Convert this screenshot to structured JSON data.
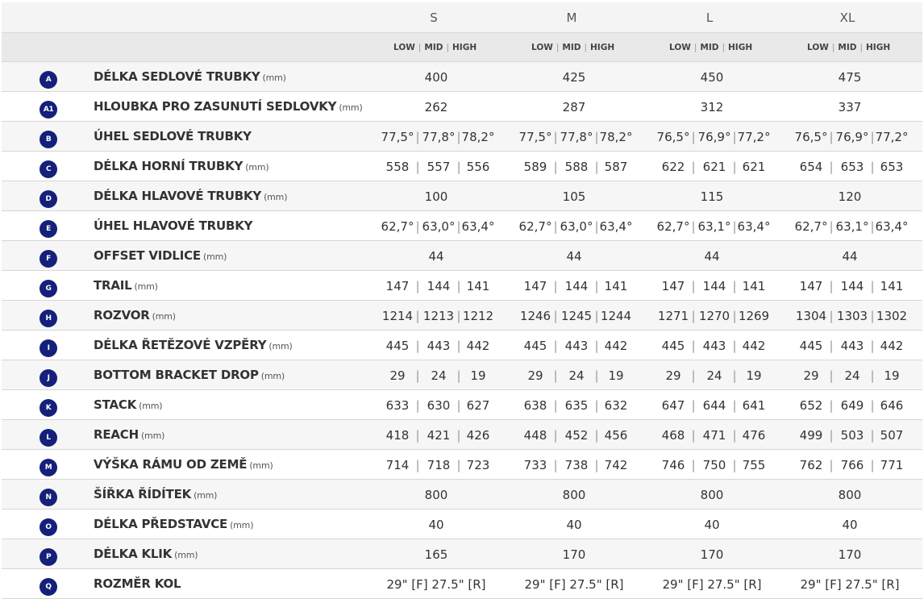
{
  "header": {
    "sizes": [
      "S",
      "M",
      "L",
      "XL"
    ],
    "sub": [
      "LOW",
      "MID",
      "HIGH"
    ],
    "sep": "|"
  },
  "rows": [
    {
      "badge": "A",
      "label": "DÉLKA SEDLOVÉ TRUBKY",
      "unit": "(mm)",
      "values": [
        [
          "400"
        ],
        [
          "425"
        ],
        [
          "450"
        ],
        [
          "475"
        ]
      ]
    },
    {
      "badge": "A1",
      "label": "HLOUBKA PRO ZASUNUTÍ SEDLOVKY",
      "unit": "(mm)",
      "values": [
        [
          "262"
        ],
        [
          "287"
        ],
        [
          "312"
        ],
        [
          "337"
        ]
      ]
    },
    {
      "badge": "B",
      "label": "ÚHEL SEDLOVÉ TRUBKY",
      "unit": "",
      "values": [
        [
          "77,5°",
          "77,8°",
          "78,2°"
        ],
        [
          "77,5°",
          "77,8°",
          "78,2°"
        ],
        [
          "76,5°",
          "76,9°",
          "77,2°"
        ],
        [
          "76,5°",
          "76,9°",
          "77,2°"
        ]
      ]
    },
    {
      "badge": "C",
      "label": "DÉLKA HORNÍ TRUBKY",
      "unit": "(mm)",
      "values": [
        [
          "558",
          "557",
          "556"
        ],
        [
          "589",
          "588",
          "587"
        ],
        [
          "622",
          "621",
          "621"
        ],
        [
          "654",
          "653",
          "653"
        ]
      ]
    },
    {
      "badge": "D",
      "label": "DÉLKA HLAVOVÉ TRUBKY",
      "unit": "(mm)",
      "values": [
        [
          "100"
        ],
        [
          "105"
        ],
        [
          "115"
        ],
        [
          "120"
        ]
      ]
    },
    {
      "badge": "E",
      "label": "ÚHEL HLAVOVÉ TRUBKY",
      "unit": "",
      "values": [
        [
          "62,7°",
          "63,0°",
          "63,4°"
        ],
        [
          "62,7°",
          "63,0°",
          "63,4°"
        ],
        [
          "62,7°",
          "63,1°",
          "63,4°"
        ],
        [
          "62,7°",
          "63,1°",
          "63,4°"
        ]
      ]
    },
    {
      "badge": "F",
      "label": "OFFSET VIDLICE",
      "unit": "(mm)",
      "values": [
        [
          "44"
        ],
        [
          "44"
        ],
        [
          "44"
        ],
        [
          "44"
        ]
      ]
    },
    {
      "badge": "G",
      "label": "TRAIL",
      "unit": "(mm)",
      "values": [
        [
          "147",
          "144",
          "141"
        ],
        [
          "147",
          "144",
          "141"
        ],
        [
          "147",
          "144",
          "141"
        ],
        [
          "147",
          "144",
          "141"
        ]
      ]
    },
    {
      "badge": "H",
      "label": "ROZVOR",
      "unit": "(mm)",
      "values": [
        [
          "1214",
          "1213",
          "1212"
        ],
        [
          "1246",
          "1245",
          "1244"
        ],
        [
          "1271",
          "1270",
          "1269"
        ],
        [
          "1304",
          "1303",
          "1302"
        ]
      ]
    },
    {
      "badge": "I",
      "label": "DÉLKA ŘETĚZOVÉ VZPĚRY",
      "unit": "(mm)",
      "values": [
        [
          "445",
          "443",
          "442"
        ],
        [
          "445",
          "443",
          "442"
        ],
        [
          "445",
          "443",
          "442"
        ],
        [
          "445",
          "443",
          "442"
        ]
      ]
    },
    {
      "badge": "J",
      "label": "BOTTOM BRACKET DROP",
      "unit": "(mm)",
      "values": [
        [
          "29",
          "24",
          "19"
        ],
        [
          "29",
          "24",
          "19"
        ],
        [
          "29",
          "24",
          "19"
        ],
        [
          "29",
          "24",
          "19"
        ]
      ]
    },
    {
      "badge": "K",
      "label": "STACK",
      "unit": "(mm)",
      "values": [
        [
          "633",
          "630",
          "627"
        ],
        [
          "638",
          "635",
          "632"
        ],
        [
          "647",
          "644",
          "641"
        ],
        [
          "652",
          "649",
          "646"
        ]
      ]
    },
    {
      "badge": "L",
      "label": "REACH",
      "unit": "(mm)",
      "values": [
        [
          "418",
          "421",
          "426"
        ],
        [
          "448",
          "452",
          "456"
        ],
        [
          "468",
          "471",
          "476"
        ],
        [
          "499",
          "503",
          "507"
        ]
      ]
    },
    {
      "badge": "M",
      "label": "VÝŠKA RÁMU OD ZEMĚ",
      "unit": "(mm)",
      "values": [
        [
          "714",
          "718",
          "723"
        ],
        [
          "733",
          "738",
          "742"
        ],
        [
          "746",
          "750",
          "755"
        ],
        [
          "762",
          "766",
          "771"
        ]
      ]
    },
    {
      "badge": "N",
      "label": "ŠÍŘKA ŘÍDÍTEK",
      "unit": "(mm)",
      "values": [
        [
          "800"
        ],
        [
          "800"
        ],
        [
          "800"
        ],
        [
          "800"
        ]
      ]
    },
    {
      "badge": "O",
      "label": "DÉLKA PŘEDSTAVCE",
      "unit": "(mm)",
      "values": [
        [
          "40"
        ],
        [
          "40"
        ],
        [
          "40"
        ],
        [
          "40"
        ]
      ]
    },
    {
      "badge": "P",
      "label": "DÉLKA KLIK",
      "unit": "(mm)",
      "values": [
        [
          "165"
        ],
        [
          "170"
        ],
        [
          "170"
        ],
        [
          "170"
        ]
      ]
    },
    {
      "badge": "Q",
      "label": "ROZMĚR KOL",
      "unit": "",
      "values": [
        [
          "29\" [F] 27.5\" [R]"
        ],
        [
          "29\" [F] 27.5\" [R]"
        ],
        [
          "29\" [F] 27.5\" [R]"
        ],
        [
          "29\" [F] 27.5\" [R]"
        ]
      ]
    }
  ]
}
